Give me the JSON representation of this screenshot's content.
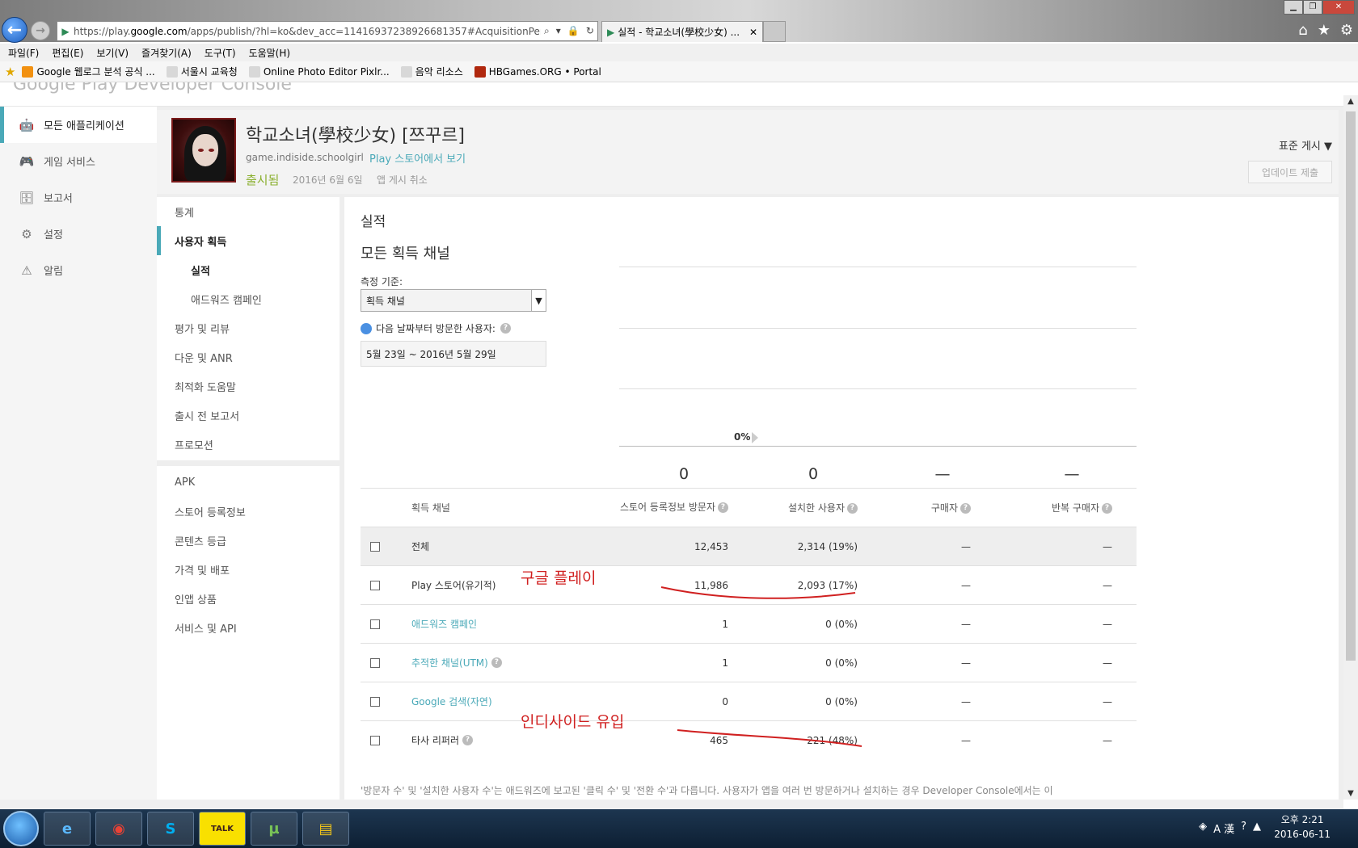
{
  "browser": {
    "url_prefix": "https://play.",
    "url_domain": "google.com",
    "url_rest": "/apps/publish/?hl=ko&dev_acc=11416937238926681357#AcquisitionPerformanc",
    "tab_title": "실적 - 학교소녀(學校少女) ...",
    "menu": [
      "파일(F)",
      "편집(E)",
      "보기(V)",
      "즐겨찾기(A)",
      "도구(T)",
      "도움말(H)"
    ],
    "favorites": [
      "Google 웹로그 분석 공식 ...",
      "서울시 교육청",
      "Online Photo Editor  Pixlr...",
      "음악 리소스",
      "HBGames.ORG • Portal"
    ]
  },
  "left_nav": [
    {
      "label": "모든 애플리케이션",
      "icon": "android-icon",
      "glyph": "🤖"
    },
    {
      "label": "게임 서비스",
      "icon": "gamepad-icon",
      "glyph": "🎮"
    },
    {
      "label": "보고서",
      "icon": "database-icon",
      "glyph": "🗄"
    },
    {
      "label": "설정",
      "icon": "gear-icon",
      "glyph": "⚙"
    },
    {
      "label": "알림",
      "icon": "warning-icon",
      "glyph": "⚠"
    }
  ],
  "app": {
    "title": "학교소녀(學校少女) [쯔꾸르]",
    "package": "game.indiside.schoolgirl",
    "store_link": "Play 스토어에서 보기",
    "status": "출시됨",
    "date": "2016년 6월 6일",
    "unpublish": "앱 게시 취소",
    "publish_mode": "표준 게시 ▼",
    "update_button": "업데이트 제출"
  },
  "sub_nav": {
    "group1": [
      "통계",
      "사용자 획득",
      "실적",
      "애드워즈 캠페인",
      "평가 및 리뷰",
      "다운 및 ANR",
      "최적화 도움말",
      "출시 전 보고서",
      "프로모션"
    ],
    "group2": [
      "APK",
      "스토어 등록정보",
      "콘텐츠 등급",
      "가격 및 배포",
      "인앱 상품",
      "서비스 및 API"
    ]
  },
  "content": {
    "title": "실적",
    "channel_title": "모든 획득 채널",
    "measure_label": "측정 기준:",
    "measure_value": "획득 채널",
    "visitor_label": "다음 날짜부터 방문한 사용자:",
    "date_range": "5월 23일 ~ 2016년 5월 29일",
    "chart_pct": "0%",
    "summary": [
      "0",
      "0",
      "—",
      "—"
    ],
    "footnote": "'방문자 수' 및 '설치한 사용자 수'는 애드워즈에 보고된 '클릭 수' 및 '전환 수'과 다릅니다. 사용자가 앱을 여러 번 방문하거나 설치하는 경우 Developer Console에서는 이"
  },
  "table": {
    "headers": {
      "channel": "획득 채널",
      "visitors": "스토어 등록정보 방문자",
      "installers": "설치한 사용자",
      "buyers": "구매자",
      "repeat_buyers": "반복 구매자"
    },
    "rows": [
      {
        "channel": "전체",
        "visitors": "12,453",
        "installers": "2,314 (19%)",
        "buyers": "—",
        "repeat": "—"
      },
      {
        "channel": "Play 스토어(유기적)",
        "visitors": "11,986",
        "installers": "2,093 (17%)",
        "buyers": "—",
        "repeat": "—"
      },
      {
        "channel": "애드워즈 캠페인",
        "visitors": "1",
        "installers": "0 (0%)",
        "buyers": "—",
        "repeat": "—"
      },
      {
        "channel": "추적한 채널(UTM)",
        "visitors": "1",
        "installers": "0 (0%)",
        "buyers": "—",
        "repeat": "—"
      },
      {
        "channel": "Google 검색(자연)",
        "visitors": "0",
        "installers": "0 (0%)",
        "buyers": "—",
        "repeat": "—"
      },
      {
        "channel": "타사 리퍼러",
        "visitors": "465",
        "installers": "221 (48%)",
        "buyers": "—",
        "repeat": "—"
      }
    ]
  },
  "annotations": [
    "구글 플레이",
    "인디사이드 유입"
  ],
  "taskbar": {
    "time": "오후 2:21",
    "date": "2016-06-11",
    "apps": [
      "ie-icon",
      "chrome-icon",
      "skype-icon",
      "kakaotalk-icon",
      "utorrent-icon",
      "explorer-icon"
    ]
  }
}
